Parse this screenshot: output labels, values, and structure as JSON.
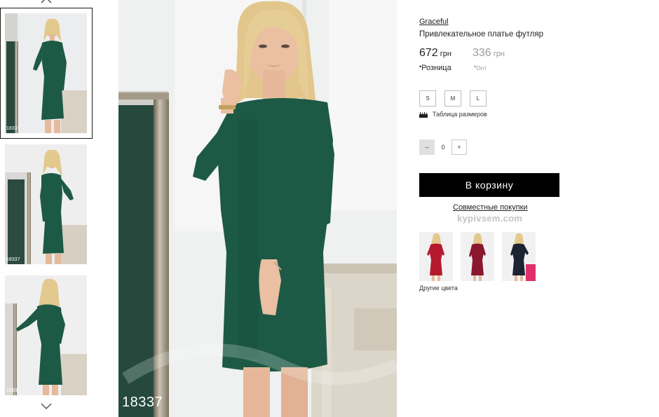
{
  "product": {
    "brand": "Graceful",
    "title": "Привлекательное платье футляр",
    "code": "18337"
  },
  "prices": {
    "retail_value": "672",
    "retail_currency": "грн",
    "retail_label": "Розница",
    "wholesale_value": "336",
    "wholesale_currency": "грн",
    "wholesale_label": "Опт"
  },
  "sizes": [
    "S",
    "M",
    "L"
  ],
  "size_table_label": "Таблица размеров",
  "quantity": {
    "minus": "–",
    "value": "0",
    "plus": "+"
  },
  "cart_button": "В корзину",
  "joint_purchases": {
    "link": "Совместные покупки",
    "watermark": "kypivsem.com"
  },
  "other_colors_label": "Другие цвета",
  "colors": {
    "dress_main": "#1d5a45",
    "other_red": "#b5192e",
    "other_burgundy": "#8a1630",
    "other_navy": "#1c2333"
  }
}
